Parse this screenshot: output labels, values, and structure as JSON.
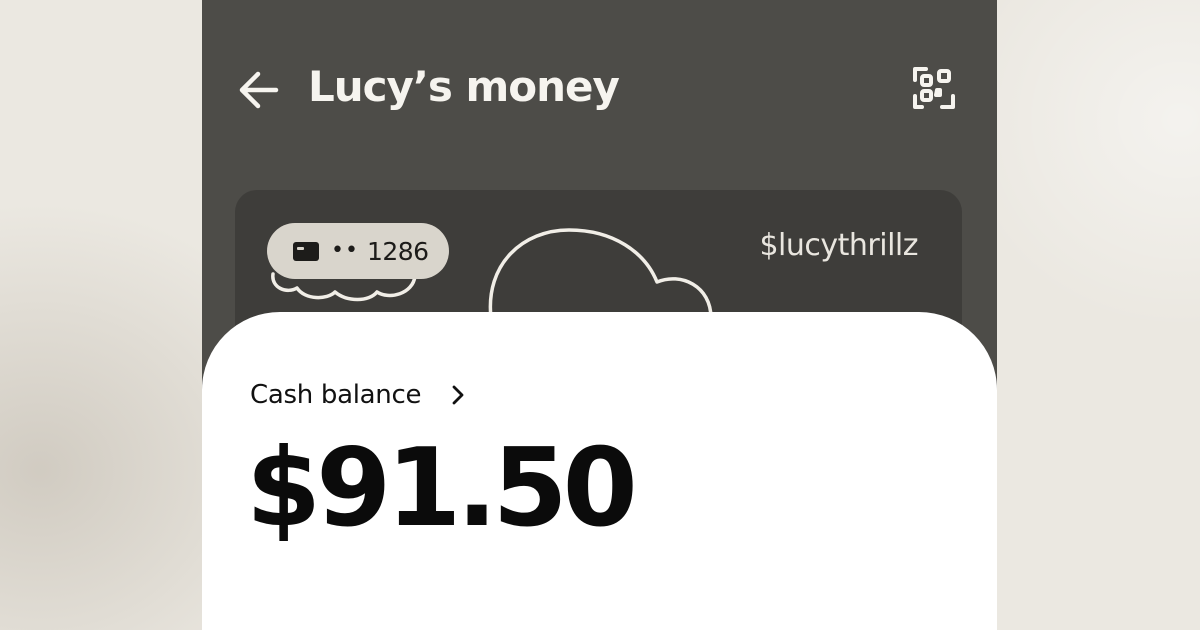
{
  "header": {
    "title": "Lucy’s money",
    "back_icon": "arrow-left-icon",
    "scan_icon": "qr-scan-icon"
  },
  "card": {
    "masked_dots": "••",
    "last4": "1286",
    "cashtag": "$lucythrillz",
    "chip_icon": "card-icon"
  },
  "balance": {
    "label": "Cash balance",
    "amount": "$91.50",
    "chevron_icon": "chevron-right-icon"
  },
  "colors": {
    "background": "#ebe8e1",
    "phone_surface": "#4d4c48",
    "card_surface": "#3e3d3a",
    "chip": "#d9d5cc",
    "sheet": "#ffffff",
    "text_light": "#f6f4ef",
    "text_dark": "#0b0b0b"
  }
}
